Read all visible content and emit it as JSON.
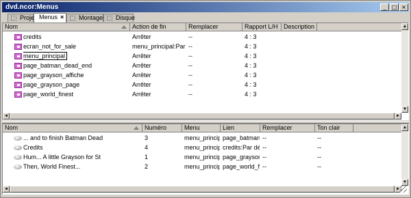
{
  "window": {
    "title": "dvd.ncor:Menus",
    "minimize_label": "_",
    "maximize_label": "□",
    "close_label": "×"
  },
  "tabs": [
    {
      "label": "Projet",
      "active": false
    },
    {
      "label": "Menus",
      "active": true,
      "close": "×"
    },
    {
      "label": "Montages",
      "active": false
    },
    {
      "label": "Disque",
      "active": false
    }
  ],
  "menus_table": {
    "columns": [
      "Nom",
      "Action de fin",
      "Remplacer",
      "Rapport L/H",
      "Description"
    ],
    "rows": [
      {
        "name": "credits",
        "action": "Arrêter",
        "replace": "--",
        "ratio": "4 : 3"
      },
      {
        "name": "ecran_not_for_sale",
        "action": "menu_principal:Par d...",
        "replace": "--",
        "ratio": "4 : 3"
      },
      {
        "name": "menu_principal",
        "action": "Arrêter",
        "replace": "--",
        "ratio": "4 : 3",
        "editing": true
      },
      {
        "name": "page_batman_dead_end",
        "action": "Arrêter",
        "replace": "--",
        "ratio": "4 : 3"
      },
      {
        "name": "page_grayson_affiche",
        "action": "Arrêter",
        "replace": "--",
        "ratio": "4 : 3"
      },
      {
        "name": "page_grayson_page",
        "action": "Arrêter",
        "replace": "--",
        "ratio": "4 : 3"
      },
      {
        "name": "page_world_finest",
        "action": "Arrêter",
        "replace": "--",
        "ratio": "4 : 3"
      }
    ]
  },
  "buttons_table": {
    "columns": [
      "Nom",
      "Numéro",
      "Menu",
      "Lien",
      "Remplacer",
      "Ton clair"
    ],
    "rows": [
      {
        "name": "... and to finish Batman Dead",
        "number": "3",
        "menu": "menu_principal",
        "link": "page_batman...",
        "replace": "--",
        "tone": "--"
      },
      {
        "name": "Credits",
        "number": "4",
        "menu": "menu_principal",
        "link": "credits:Par déf...",
        "replace": "--",
        "tone": "--"
      },
      {
        "name": "Hum... A little Grayson for St",
        "number": "1",
        "menu": "menu_principal",
        "link": "page_grayson...",
        "replace": "--",
        "tone": "--"
      },
      {
        "name": "Then, World Finest...",
        "number": "2",
        "menu": "menu_principal",
        "link": "page_world_fi...",
        "replace": "--",
        "tone": "--"
      }
    ]
  },
  "scroll": {
    "up": "▲",
    "down": "▼",
    "left": "◄",
    "right": "►"
  },
  "icons": {
    "menu_row": "menu-icon",
    "button_row": "button-icon",
    "tab": "tab-icon"
  }
}
